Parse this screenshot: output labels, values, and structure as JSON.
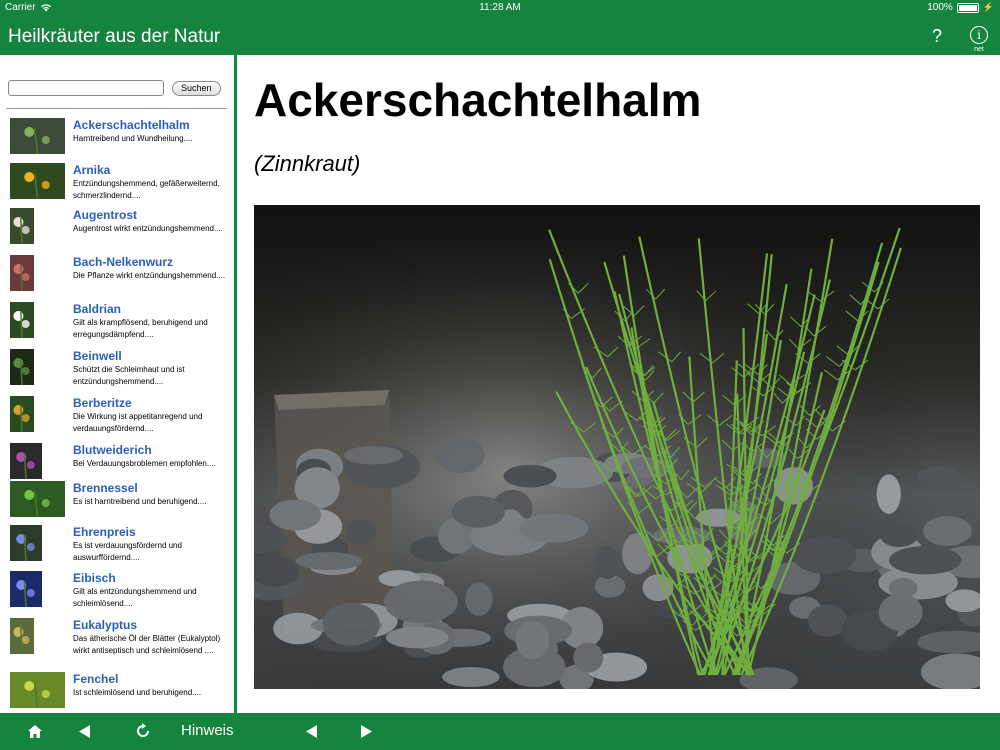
{
  "status_bar": {
    "carrier": "Carrier",
    "time": "11:28 AM",
    "battery": "100%"
  },
  "navbar": {
    "title": "Heilkräuter aus der Natur",
    "help": "?",
    "info_symbol": "i",
    "info_label": "net"
  },
  "search": {
    "value": "",
    "placeholder": "",
    "button_label": "Suchen"
  },
  "herbs": [
    {
      "name": "Ackerschachtelhalm",
      "desc": "Harntreibend und Wundheilung....",
      "image": "horsetail-thumb"
    },
    {
      "name": "Arnika",
      "desc": "Entzündungshemmend, gefäßerweiternd, schmerzlindernd....",
      "image": "arnica-thumb"
    },
    {
      "name": "Augentrost",
      "desc": "Augentrost wirkt entzündungshemmend....",
      "image": "eyebright-thumb"
    },
    {
      "name": "Bach-Nelkenwurz",
      "desc": "Die Pflanze wirkt entzündungshemmend....",
      "image": "water-avens-thumb"
    },
    {
      "name": "Baldrian",
      "desc": "Gilt als krampflösend, beruhigend und erregungsdämpfend....",
      "image": "valerian-thumb"
    },
    {
      "name": "Beinwell",
      "desc": "Schützt die Schleimhaut und ist entzündungshemmend....",
      "image": "comfrey-thumb"
    },
    {
      "name": "Berberitze",
      "desc": "Die Wirkung ist appetitanregend und verdauungsfördernd....",
      "image": "barberry-thumb"
    },
    {
      "name": "Blutweiderich",
      "desc": "Bei Verdauungsbroblemen empfohlen....",
      "image": "loosestrife-thumb"
    },
    {
      "name": "Brennessel",
      "desc": "Es ist harntreibend und beruhigend....",
      "image": "nettle-thumb"
    },
    {
      "name": "Ehrenpreis",
      "desc": "Es ist verdauungsfördernd und auswurffördernd....",
      "image": "speedwell-thumb"
    },
    {
      "name": "Eibisch",
      "desc": "Gilt als entzündungshemmend und schleimlösend....",
      "image": "marshmallow-thumb"
    },
    {
      "name": "Eukalyptus",
      "desc": "Das ätherische Öl der Blätter (Eukalyptol) wirkt antiseptisch und schleimlösend ....",
      "image": "eucalyptus-thumb"
    },
    {
      "name": "Fenchel",
      "desc": "Ist schleimlösend und beruhigend....",
      "image": "fennel-thumb"
    }
  ],
  "detail": {
    "title": "Ackerschachtelhalm",
    "subtitle": "(Zinnkraut)",
    "image": "horsetail-photo"
  },
  "toolbar": {
    "home": "home-icon",
    "back": "back-arrow-icon",
    "reload": "reload-icon",
    "hint_label": "Hinweis",
    "prev": "prev-arrow-icon",
    "next": "next-arrow-icon"
  },
  "colors": {
    "brand_green": "#15843f",
    "link_blue": "#2b5fb8"
  }
}
